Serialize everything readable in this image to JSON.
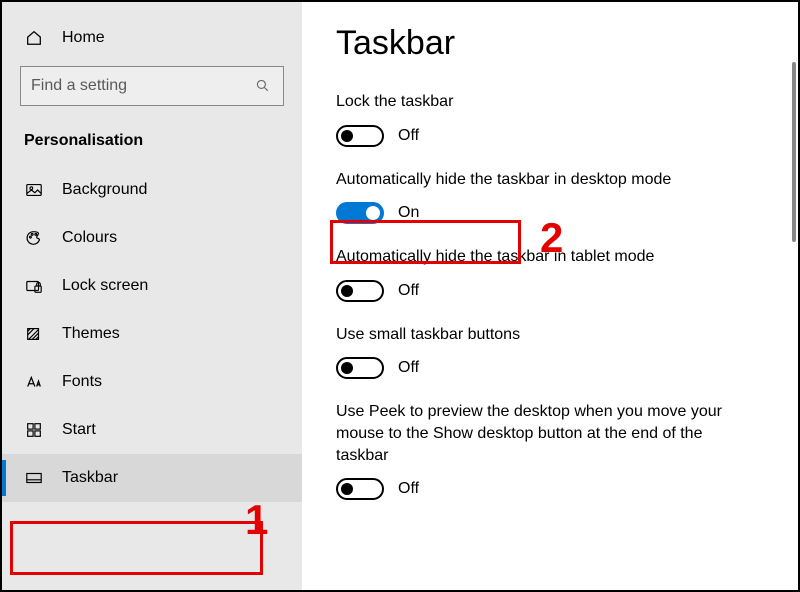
{
  "sidebar": {
    "home_label": "Home",
    "search_placeholder": "Find a setting",
    "section_title": "Personalisation",
    "items": [
      {
        "label": "Background"
      },
      {
        "label": "Colours"
      },
      {
        "label": "Lock screen"
      },
      {
        "label": "Themes"
      },
      {
        "label": "Fonts"
      },
      {
        "label": "Start"
      },
      {
        "label": "Taskbar"
      }
    ]
  },
  "main": {
    "title": "Taskbar",
    "settings": [
      {
        "label": "Lock the taskbar",
        "state": "Off"
      },
      {
        "label": "Automatically hide the taskbar in desktop mode",
        "state": "On"
      },
      {
        "label": "Automatically hide the taskbar in tablet mode",
        "state": "Off"
      },
      {
        "label": "Use small taskbar buttons",
        "state": "Off"
      },
      {
        "label": "Use Peek to preview the desktop when you move your mouse to the Show desktop button at the end of the taskbar",
        "state": "Off"
      }
    ]
  },
  "annotations": {
    "num1": "1",
    "num2": "2"
  }
}
